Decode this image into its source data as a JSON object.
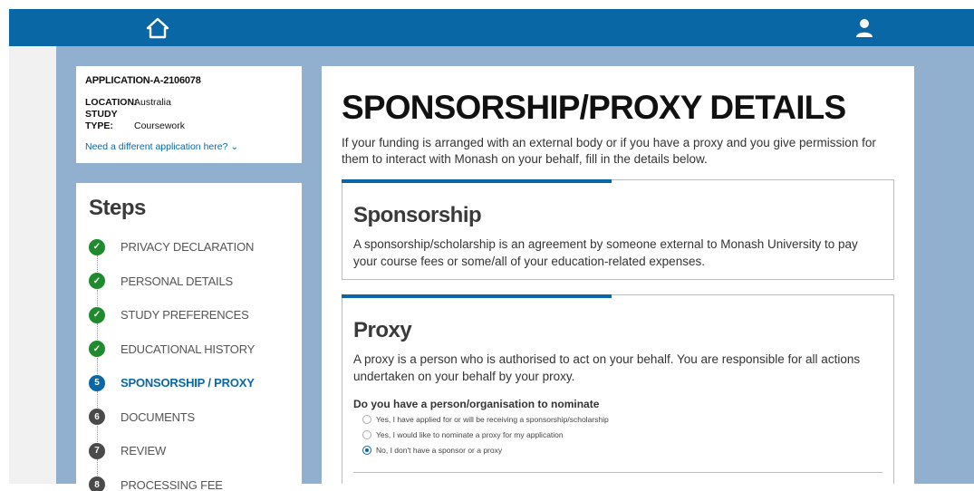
{
  "header": {
    "home_icon": "home-icon",
    "user_icon": "user-icon"
  },
  "application": {
    "id": "APPLICATION-A-2106078",
    "location_label": "LOCATION:",
    "location": "Australia",
    "study_type_label": "STUDY TYPE:",
    "study_type": "Coursework",
    "different_link": "Need a different application here? ⌄"
  },
  "steps": {
    "title": "Steps",
    "items": [
      {
        "label": "PRIVACY DECLARATION",
        "state": "done",
        "mark": "✓"
      },
      {
        "label": "PERSONAL DETAILS",
        "state": "done",
        "mark": "✓"
      },
      {
        "label": "STUDY PREFERENCES",
        "state": "done",
        "mark": "✓"
      },
      {
        "label": "EDUCATIONAL HISTORY",
        "state": "done",
        "mark": "✓"
      },
      {
        "label": "SPONSORSHIP / PROXY",
        "state": "current",
        "mark": "5"
      },
      {
        "label": "DOCUMENTS",
        "state": "todo",
        "mark": "6"
      },
      {
        "label": "REVIEW",
        "state": "todo",
        "mark": "7"
      },
      {
        "label": "PROCESSING FEE",
        "state": "todo",
        "mark": "8"
      }
    ]
  },
  "main": {
    "title": "SPONSORSHIP/PROXY DETAILS",
    "intro": "If your funding is arranged with an external body or if you have a proxy and you give permission for them to interact with Monash on your behalf, fill in the details below.",
    "sponsorship": {
      "heading": "Sponsorship",
      "text": "A sponsorship/scholarship is an agreement by someone external to Monash University to pay your course fees or some/all of your education-related expenses."
    },
    "proxy": {
      "heading": "Proxy",
      "text": "A proxy is a person who is authorised to act on your behalf. You are responsible for all actions undertaken on your behalf by your proxy.",
      "question": "Do you have a person/organisation to nominate",
      "options": [
        {
          "label": "Yes, I have applied for or will be receiving a sponsorship/scholarship",
          "checked": false
        },
        {
          "label": "Yes, I would like to nominate a proxy for my application",
          "checked": false
        },
        {
          "label": "No, I don't have a sponsor or a proxy",
          "checked": true
        }
      ]
    }
  },
  "colors": {
    "brand": "#0a67a6",
    "done": "#1f8b2e",
    "todo": "#4a4a4a",
    "background": "#91afcf"
  }
}
